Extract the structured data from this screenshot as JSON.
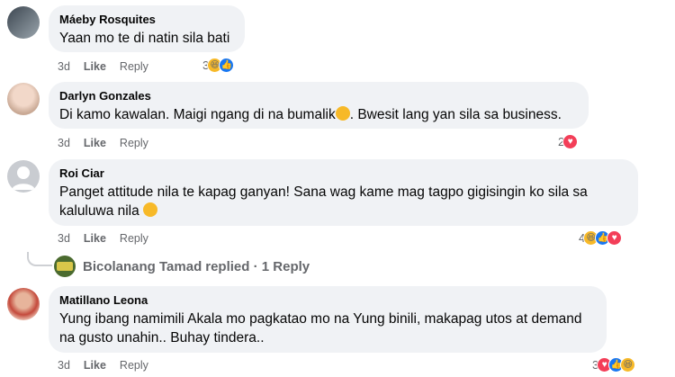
{
  "comments": [
    {
      "author": "Máeby Rosquites",
      "text": "Yaan mo te di natin sila bati",
      "time": "3d",
      "like": "Like",
      "reply": "Reply",
      "reaction_count": "3",
      "reactions": [
        "haha-icon",
        "like-icon"
      ]
    },
    {
      "author": "Darlyn Gonzales",
      "text_before": "Di kamo kawalan. Maigi ngang di na bumalik",
      "text_after": ". Bwesit lang yan sila sa business.",
      "time": "3d",
      "like": "Like",
      "reply": "Reply",
      "reaction_count": "2",
      "reactions": [
        "love-icon"
      ]
    },
    {
      "author": "Roi Ciar",
      "text_line1": "Panget attitude nila te kapag ganyan! Sana wag kame mag tagpo gigisingin ko sila sa",
      "text_line2": "kaluluwa nila",
      "time": "3d",
      "like": "Like",
      "reply": "Reply",
      "reaction_count": "4",
      "reactions": [
        "haha-icon",
        "like-icon",
        "love-icon"
      ]
    },
    {
      "author": "Matillano Leona",
      "text_line1": "Yung ibang namimili Akala mo pagkatao mo na Yung binili, makapag utos at demand",
      "text_line2": "na gusto unahin.. Buhay tindera..",
      "time": "3d",
      "like": "Like",
      "reply": "Reply",
      "reaction_count": "3",
      "reactions": [
        "love-icon",
        "like-icon",
        "haha-icon"
      ]
    }
  ],
  "replies_link": {
    "name": "Bicolanang Tamad",
    "text": "replied · 1 Reply"
  },
  "colors": {
    "bubble": "#f0f2f5",
    "meta": "#65676b",
    "like_blue": "#1877f2",
    "love_red": "#f33e58",
    "haha_yellow": "#f7b928"
  }
}
